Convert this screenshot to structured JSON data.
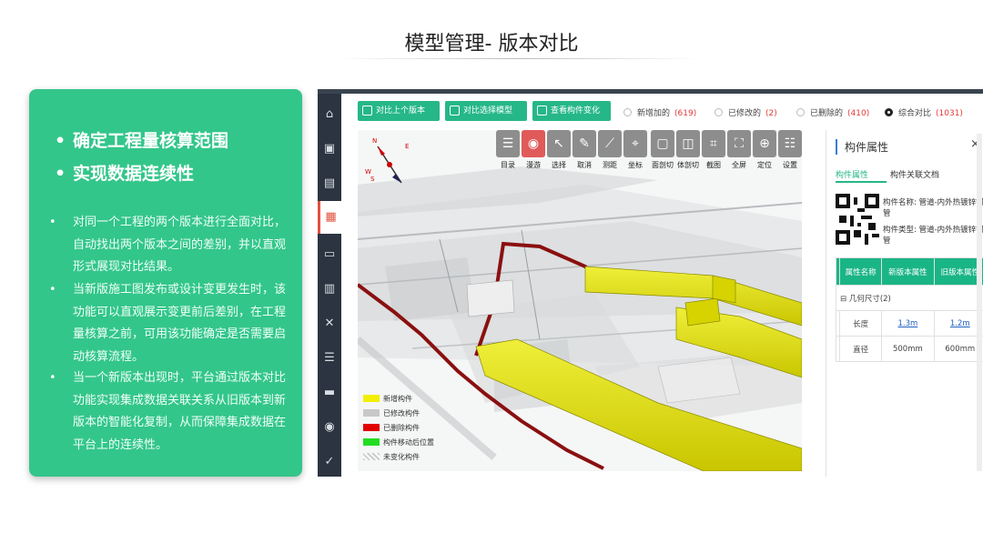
{
  "slide": {
    "title": "模型管理- 版本对比"
  },
  "left_card": {
    "headlines": [
      "确定工程量核算范围",
      "实现数据连续性"
    ],
    "bullet_char": "•",
    "points": [
      "对同一个工程的两个版本进行全面对比，自动找出两个版本之间的差别，并以直观形式展现对比结果。",
      "当新版施工图发布或设计变更发生时，该功能可以直观展示变更前后差别，在工程量核算之前，可用该功能确定是否需要启动核算流程。",
      "当一个新版本出现时，平台通过版本对比功能实现集成数据关联关系从旧版本到新版本的智能化复制，从而保障集成数据在平台上的连续性。"
    ]
  },
  "app": {
    "sidebar_icons": [
      "home-icon",
      "monitor-icon",
      "building-icon",
      "calendar-icon",
      "screen-icon",
      "bar-chart-icon",
      "tools-icon",
      "list-icon",
      "display-icon",
      "location-icon",
      "shield-check-icon"
    ],
    "toolbar": {
      "buttons": [
        "对比上个版本",
        "对比选择模型",
        "查看构件变化"
      ],
      "filters": [
        {
          "label": "新增加的",
          "count": "(619)",
          "selected": false
        },
        {
          "label": "已修改的",
          "count": "(2)",
          "selected": false
        },
        {
          "label": "已删除的",
          "count": "(410)",
          "selected": false
        },
        {
          "label": "综合对比",
          "count": "(1031)",
          "selected": true
        }
      ]
    },
    "viewer_tools": [
      {
        "icon": "list-icon",
        "label": "目录"
      },
      {
        "icon": "pin-icon",
        "label": "漫游"
      },
      {
        "icon": "cursor-icon",
        "label": "选择"
      },
      {
        "icon": "brush-icon",
        "label": "取消"
      },
      {
        "icon": "ruler-icon",
        "label": "测距"
      },
      {
        "icon": "crosshair-icon",
        "label": "坐标"
      },
      {
        "icon": "section-plane-icon",
        "label": "面剖切"
      },
      {
        "icon": "section-box-icon",
        "label": "体剖切"
      },
      {
        "icon": "crop-icon",
        "label": "截图"
      },
      {
        "icon": "fullscreen-icon",
        "label": "全屏"
      },
      {
        "icon": "target-icon",
        "label": "定位"
      },
      {
        "icon": "settings-icon",
        "label": "设置"
      }
    ],
    "compass": {
      "north": "N",
      "east": "E",
      "west": "W",
      "south": "S"
    },
    "legend": [
      {
        "label": "新增构件",
        "color": "#f2ef00"
      },
      {
        "label": "已修改构件",
        "color": "#c8c8c8"
      },
      {
        "label": "已删除构件",
        "color": "#e00000"
      },
      {
        "label": "构件移动后位置",
        "color": "#22dd22"
      },
      {
        "label": "未变化构件",
        "color": "checker"
      }
    ],
    "properties": {
      "title": "构件属性",
      "close": "×",
      "tabs": [
        "构件属性",
        "构件关联文档"
      ],
      "name_label": "构件名称:",
      "name_value": "管道-内外热镀锌钢管",
      "type_label": "构件类型:",
      "type_value": "管道-内外热镀锌钢管",
      "table": {
        "headers": [
          "属性名称",
          "新版本属性",
          "旧版本属性"
        ],
        "group": "几何尺寸(2)",
        "rows": [
          {
            "name": "长度",
            "new": "1.3m",
            "old": "1.2m"
          },
          {
            "name": "直径",
            "new": "500mm",
            "old": "600mm"
          }
        ]
      }
    }
  }
}
